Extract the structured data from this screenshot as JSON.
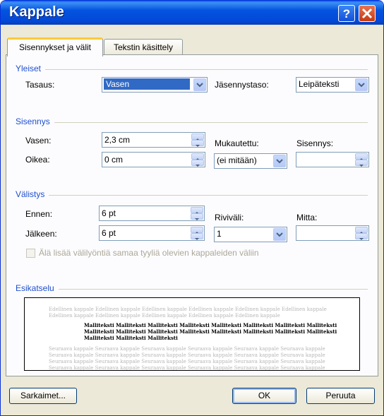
{
  "window": {
    "title": "Kappale"
  },
  "tabs": [
    {
      "label": "Sisennykset ja välit",
      "active": true
    },
    {
      "label": "Tekstin käsittely",
      "active": false
    }
  ],
  "general": {
    "title": "Yleiset",
    "alignment_label": "Tasaus:",
    "alignment_value": "Vasen",
    "outline_label": "Jäsennystaso:",
    "outline_value": "Leipäteksti"
  },
  "indent": {
    "title": "Sisennys",
    "left_label": "Vasen:",
    "left_value": "2,3 cm",
    "right_label": "Oikea:",
    "right_value": "0 cm",
    "special_label": "Mukautettu:",
    "special_value": "(ei mitään)",
    "by_label": "Sisennys:",
    "by_value": ""
  },
  "spacing": {
    "title": "Välistys",
    "before_label": "Ennen:",
    "before_value": "6 pt",
    "after_label": "Jälkeen:",
    "after_value": "6 pt",
    "line_label": "Riviväli:",
    "line_value": "1",
    "at_label": "Mitta:",
    "at_value": "",
    "no_space_label": "Älä lisää välilyöntiä samaa tyyliä olevien kappaleiden väliin",
    "no_space_checked": false
  },
  "preview": {
    "title": "Esikatselu",
    "before_lines": [
      "Edellinen kappale Edellinen kappale Edellinen kappale Edellinen kappale Edellinen kappale Edellinen kappale",
      "Edellinen kappale Edellinen kappale Edellinen kappale Edellinen kappale Edellinen kappale"
    ],
    "sample_lines": [
      "Malliteksti Malliteksti Malliteksti Malliteksti Malliteksti Malliteksti Malliteksti Malliteksti Malliteksti",
      "Malliteksti Malliteksti Malliteksti Malliteksti Malliteksti Malliteksti Malliteksti Malliteksti Malliteksti",
      "Malliteksti Malliteksti Malliteksti"
    ],
    "after_lines": [
      "Seuraava kappale Seuraava kappale Seuraava kappale Seuraava kappale Seuraava kappale Seuraava kappale",
      "Seuraava kappale Seuraava kappale Seuraava kappale Seuraava kappale Seuraava kappale Seuraava kappale",
      "Seuraava kappale Seuraava kappale Seuraava kappale Seuraava kappale Seuraava kappale Seuraava kappale",
      "Seuraava kappale Seuraava kappale Seuraava kappale Seuraava kappale Seuraava kappale Seuraava kappale"
    ]
  },
  "buttons": {
    "tabs": "Sarkaimet...",
    "ok": "OK",
    "cancel": "Peruuta"
  },
  "colors": {
    "title_bar": "#0453e0",
    "group_title": "#1f4fce",
    "selection": "#316ac5",
    "close_button": "#c23a13"
  }
}
